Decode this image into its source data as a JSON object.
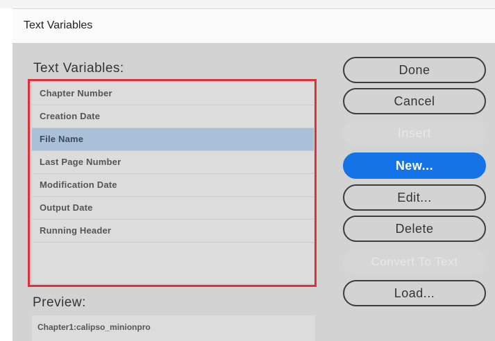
{
  "dialog": {
    "title": "Text Variables"
  },
  "variables": {
    "label": "Text Variables:",
    "items": [
      {
        "label": "Chapter Number",
        "selected": false
      },
      {
        "label": "Creation Date",
        "selected": false
      },
      {
        "label": "File Name",
        "selected": true
      },
      {
        "label": "Last Page Number",
        "selected": false
      },
      {
        "label": "Modification Date",
        "selected": false
      },
      {
        "label": "Output Date",
        "selected": false
      },
      {
        "label": "Running Header",
        "selected": false
      }
    ]
  },
  "preview": {
    "label": "Preview:",
    "value": "Chapter1:calipso_minionpro"
  },
  "buttons": {
    "done": "Done",
    "cancel": "Cancel",
    "insert": "Insert",
    "new": "New...",
    "edit": "Edit...",
    "delete": "Delete",
    "convert": "Convert To Text",
    "load": "Load..."
  },
  "colors": {
    "accent": "#1473e6",
    "selection": "#a9c0d8",
    "highlight": "#e0303a"
  }
}
